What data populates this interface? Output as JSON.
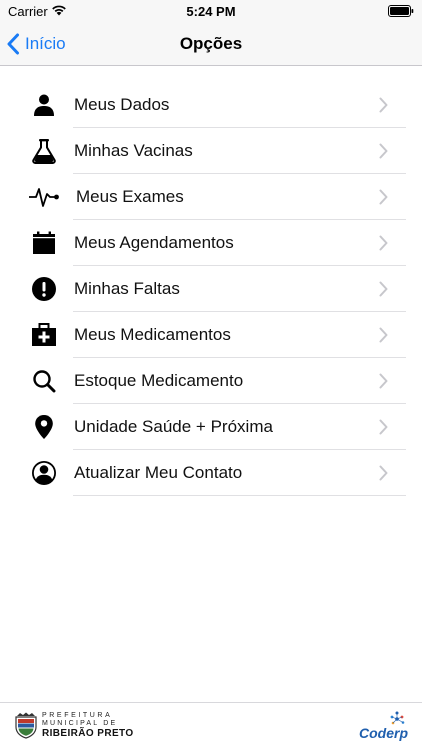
{
  "status_bar": {
    "carrier": "Carrier",
    "time": "5:24 PM"
  },
  "nav": {
    "back_label": "Início",
    "title": "Opções"
  },
  "menu": {
    "items": [
      {
        "label": "Meus Dados",
        "icon": "user-icon"
      },
      {
        "label": "Minhas Vacinas",
        "icon": "flask-icon"
      },
      {
        "label": "Meus Exames",
        "icon": "pulse-icon"
      },
      {
        "label": "Meus Agendamentos",
        "icon": "calendar-icon"
      },
      {
        "label": "Minhas Faltas",
        "icon": "alert-icon"
      },
      {
        "label": "Meus Medicamentos",
        "icon": "medical-kit-icon"
      },
      {
        "label": "Estoque Medicamento",
        "icon": "search-icon"
      },
      {
        "label": "Unidade Saúde + Próxima",
        "icon": "location-pin-icon"
      },
      {
        "label": "Atualizar Meu Contato",
        "icon": "user-circle-icon"
      }
    ]
  },
  "footer": {
    "prefeitura_line1": "PREFEITURA",
    "prefeitura_line2": "MUNICIPAL DE",
    "prefeitura_line3": "RIBEIRÃO PRETO",
    "coderp": "Coderp"
  },
  "colors": {
    "accent": "#1a7bf5",
    "chevron": "#c7c7cc",
    "coderp": "#1f5fae"
  }
}
